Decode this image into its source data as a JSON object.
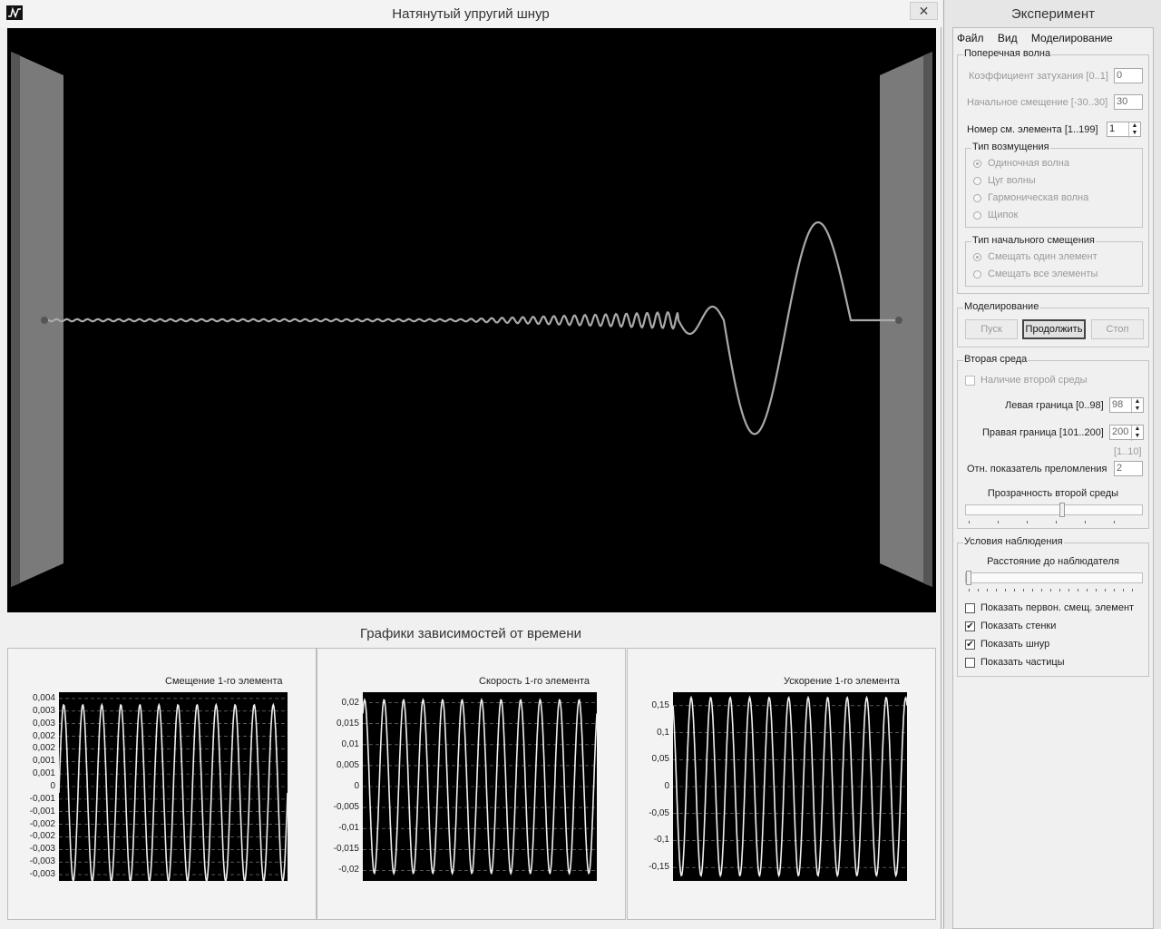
{
  "main_window": {
    "title": "Натянутый упругий шнур",
    "close_label": "✕",
    "graphs_title": "Графики зависимостей от времени"
  },
  "graphs": [
    {
      "title": "Смещение 1-го элемента",
      "yticks": [
        "0,004",
        "0,003",
        "0,003",
        "0,002",
        "0,002",
        "0,001",
        "0,001",
        "0",
        "-0,001",
        "-0,001",
        "-0,002",
        "-0,002",
        "-0,003",
        "-0,003",
        "-0,003"
      ]
    },
    {
      "title": "Скорость 1-го элемента",
      "yticks": [
        "0,02",
        "0,015",
        "0,01",
        "0,005",
        "0",
        "-0,005",
        "-0,01",
        "-0,015",
        "-0,02"
      ]
    },
    {
      "title": "Ускорение 1-го элемента",
      "yticks": [
        "0,15",
        "0,1",
        "0,05",
        "0",
        "-0,05",
        "-0,1",
        "-0,15"
      ]
    }
  ],
  "chart_data": [
    {
      "type": "line",
      "title": "Смещение 1-го элемента",
      "ylim": [
        -0.0035,
        0.004
      ],
      "cycles": 12,
      "amplitude": 0.0035
    },
    {
      "type": "line",
      "title": "Скорость 1-го элемента",
      "ylim": [
        -0.025,
        0.025
      ],
      "cycles": 12,
      "amplitude": 0.023
    },
    {
      "type": "line",
      "title": "Ускорение 1-го элемента",
      "ylim": [
        -0.18,
        0.18
      ],
      "cycles": 12,
      "amplitude": 0.17
    }
  ],
  "side": {
    "title": "Эксперимент",
    "menu": [
      "Файл",
      "Вид",
      "Моделирование"
    ],
    "transverse": {
      "group": "Поперечная волна",
      "damping_label": "Коэффициент затухания  [0..1]",
      "damping_value": "0",
      "offset_label": "Начальное смещение  [-30..30]",
      "offset_value": "30",
      "element_label": "Номер см. элемента  [1..199]",
      "element_value": "1",
      "disturbance_group": "Тип возмущения",
      "disturbance_options": [
        "Одиночная волна",
        "Цуг волны",
        "Гармоническая волна",
        "Щипок"
      ],
      "initial_group": "Тип начального смещения",
      "initial_options": [
        "Смещать один элемент",
        "Смещать все элементы"
      ]
    },
    "modeling": {
      "group": "Моделирование",
      "start": "Пуск",
      "continue": "Продолжить",
      "stop": "Стоп"
    },
    "second_medium": {
      "group": "Вторая среда",
      "presence_label": "Наличие второй среды",
      "left_label": "Левая граница [0..98]",
      "left_value": "98",
      "right_label": "Правая граница [101..200]",
      "right_value": "200",
      "range_hint": "[1..10]",
      "index_label": "Отн. показатель преломления",
      "index_value": "2",
      "transparency_label": "Прозрачность второй среды",
      "transparency_level": 0.55
    },
    "observation": {
      "group": "Условия наблюдения",
      "distance_label": "Расстояние до наблюдателя",
      "distance_level": 0.0,
      "checkboxes": [
        {
          "label": "Показать первон. смещ. элемент",
          "checked": false
        },
        {
          "label": "Показать стенки",
          "checked": true
        },
        {
          "label": "Показать шнур",
          "checked": true
        },
        {
          "label": "Показать частицы",
          "checked": false
        }
      ]
    }
  }
}
